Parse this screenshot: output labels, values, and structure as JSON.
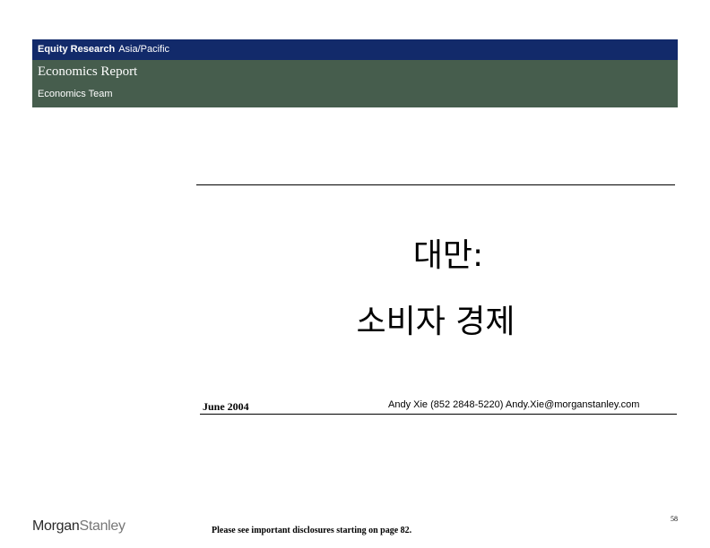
{
  "header": {
    "category": "Equity Research",
    "region": "Asia/Pacific",
    "report_type": "Economics Report",
    "team": "Economics Team"
  },
  "title": {
    "line1": "대만:",
    "line2": "소비자 경제"
  },
  "meta": {
    "date": "June 2004",
    "author": "Andy Xie  (852 2848-5220)  Andy.Xie@morganstanley.com"
  },
  "footer": {
    "page_number": "58",
    "disclosure": "Please see important disclosures starting on page 82.",
    "logo_first": "Morgan",
    "logo_second": "Stanley"
  },
  "colors": {
    "header_band": "#122a6a",
    "report_band": "#465d4d"
  }
}
